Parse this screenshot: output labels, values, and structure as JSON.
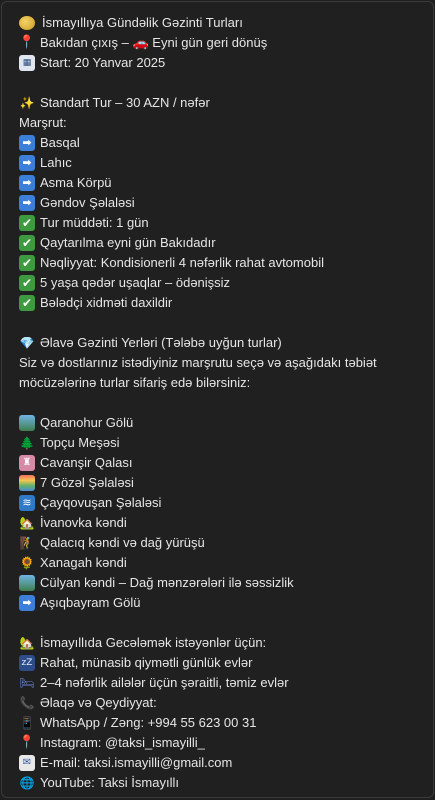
{
  "lines": [
    {
      "icon": "gold-coin-icon",
      "text": "İsmayıllıya Gündəlik Gəzinti Turları"
    },
    {
      "icon": "round-pushpin-icon",
      "text": "Bakıdan çıxış –  🚗 Eyni gün geri dönüş"
    },
    {
      "icon": "calendar-icon",
      "text": "Start: 20 Yanvar 2025"
    },
    {
      "icon": "",
      "text": ""
    },
    {
      "icon": "sparkles-icon",
      "text": "Standart Tur – 30 AZN / nəfər"
    },
    {
      "icon": "",
      "text": "Marşrut:"
    },
    {
      "icon": "right-arrow-icon",
      "text": "Basqal"
    },
    {
      "icon": "right-arrow-icon",
      "text": "Lahıc"
    },
    {
      "icon": "right-arrow-icon",
      "text": "Asma Körpü"
    },
    {
      "icon": "right-arrow-icon",
      "text": "Gəndov Şəlaləsi"
    },
    {
      "icon": "check-mark-icon",
      "text": "Tur müddəti: 1 gün"
    },
    {
      "icon": "check-mark-icon",
      "text": "Qaytarılma eyni gün Bakıdadır"
    },
    {
      "icon": "check-mark-icon",
      "text": "Nəqliyyat: Kondisionerli 4 nəfərlik rahat avtomobil"
    },
    {
      "icon": "check-mark-icon",
      "text": "5 yaşa qədər uşaqlar – ödənişsiz"
    },
    {
      "icon": "check-mark-icon",
      "text": "Bələdçi xidməti daxildir"
    },
    {
      "icon": "",
      "text": ""
    },
    {
      "icon": "gem-icon",
      "text": "Əlavə Gəzinti Yerləri (Tələbə uyğun turlar)"
    },
    {
      "icon": "",
      "text": "Siz və dostlarınız istədiyiniz marşrutu seçə və aşağıdakı təbiət"
    },
    {
      "icon": "",
      "text": "möcüzələrinə turlar sifariş edə bilərsiniz:"
    },
    {
      "icon": "",
      "text": ""
    },
    {
      "icon": "framed-landscape-icon",
      "text": "Qaranohur Gölü"
    },
    {
      "icon": "evergreen-tree-icon",
      "text": "Topçu Meşəsi"
    },
    {
      "icon": "castle-icon",
      "text": "Cavanşir Qalası"
    },
    {
      "icon": "rainbow-icon",
      "text": "7 Gözəl Şəlaləsi"
    },
    {
      "icon": "water-wave-icon",
      "text": "Çayqovuşan Şəlaləsi"
    },
    {
      "icon": "house-icon",
      "text": "İvanovka kəndi"
    },
    {
      "icon": "hiking-person-icon",
      "text": "Qalacıq kəndi və dağ yürüşü"
    },
    {
      "icon": "sunflower-icon",
      "text": "Xanagah kəndi"
    },
    {
      "icon": "framed-landscape-icon",
      "text": "Cülyan kəndi – Dağ mənzərələri ilə səssizlik"
    },
    {
      "icon": "right-arrow-icon",
      "text": "Aşıqbayram Gölü"
    },
    {
      "icon": "",
      "text": ""
    },
    {
      "icon": "house-icon",
      "text": "İsmayıllıda Gecələmək istəyənlər üçün:"
    },
    {
      "icon": "sleeping-icon",
      "text": "Rahat, münasib qiymətli günlük evlər"
    },
    {
      "icon": "bed-icon",
      "text": "2–4 nəfərlik ailələr üçün şəraitli, təmiz evlər"
    },
    {
      "icon": "telephone-icon",
      "text": "Əlaqə və Qeydiyyat:"
    },
    {
      "icon": "mobile-phone-icon",
      "text": "WhatsApp / Zəng: +994 55 623 00 31"
    },
    {
      "icon": "round-pushpin-icon",
      "text": "Instagram: @taksi_ismayilli_"
    },
    {
      "icon": "email-icon",
      "text": "E-mail: taksi.ismayilli@gmail.com"
    },
    {
      "icon": "globe-icon",
      "text": "YouTube: Taksi İsmayıllı"
    }
  ]
}
